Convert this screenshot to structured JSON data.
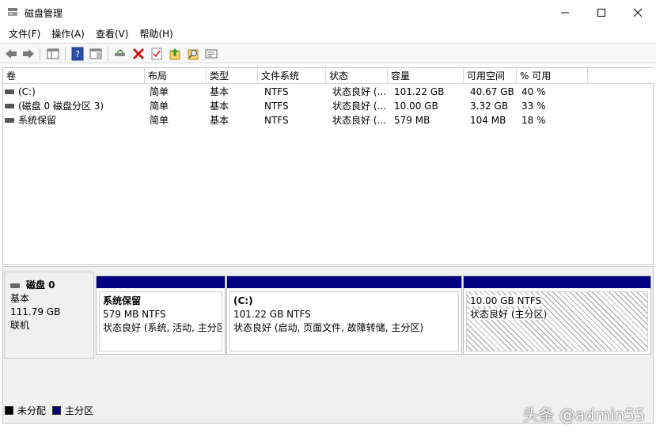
{
  "window": {
    "title": "磁盘管理"
  },
  "menu": [
    {
      "label": "文件(F)"
    },
    {
      "label": "操作(A)"
    },
    {
      "label": "查看(V)"
    },
    {
      "label": "帮助(H)"
    }
  ],
  "toolbar": {
    "icons": [
      "back-icon",
      "forward-icon",
      "console-tree-icon",
      "help-icon",
      "show-pane-icon",
      "connect-icon",
      "delete-icon",
      "check-icon",
      "export-icon",
      "search-icon",
      "properties-icon"
    ]
  },
  "table": {
    "columns": [
      "卷",
      "布局",
      "类型",
      "文件系统",
      "状态",
      "容量",
      "可用空间",
      "% 可用"
    ],
    "rows": [
      [
        "(C:)",
        "简单",
        "基本",
        "NTFS",
        "状态良好 (...",
        "101.22 GB",
        "40.67 GB",
        "40 %"
      ],
      [
        "(磁盘 0 磁盘分区 3)",
        "简单",
        "基本",
        "NTFS",
        "状态良好 (...",
        "10.00 GB",
        "3.32 GB",
        "33 %"
      ],
      [
        "系统保留",
        "简单",
        "基本",
        "NTFS",
        "状态良好 (...",
        "579 MB",
        "104 MB",
        "18 %"
      ]
    ]
  },
  "disk": {
    "name": "磁盘 0",
    "type": "基本",
    "size": "111.79 GB",
    "status": "联机"
  },
  "partitions": [
    {
      "name": "系统保留",
      "size": "579 MB NTFS",
      "status": "状态良好 (系统, 活动, 主分区)"
    },
    {
      "name": "(C:)",
      "size": "101.22 GB NTFS",
      "status": "状态良好 (启动, 页面文件, 故障转储, 主分区)"
    },
    {
      "name": "",
      "size": "10.00 GB NTFS",
      "status": "状态良好 (主分区)"
    }
  ],
  "legend": [
    {
      "label": "未分配",
      "color": "#000000"
    },
    {
      "label": "主分区",
      "color": "#000080"
    }
  ],
  "watermark": "头条 @admin55"
}
